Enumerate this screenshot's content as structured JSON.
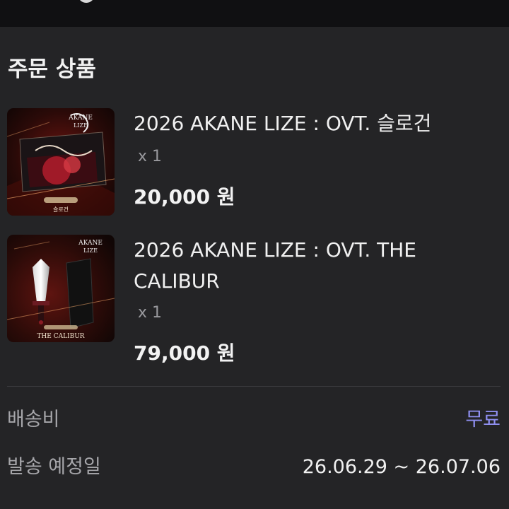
{
  "order": {
    "section_title": "주문 상품",
    "items": [
      {
        "name": "2026 AKANE LIZE : OVT. 슬로건",
        "quantity": "x 1",
        "price": "20,000 원",
        "thumbnail_caption": "슬로건"
      },
      {
        "name": "2026 AKANE LIZE : OVT. THE CALIBUR",
        "quantity": "x 1",
        "price": "79,000 원",
        "thumbnail_caption": "THE CALIBUR"
      }
    ]
  },
  "summary": {
    "shipping_label": "배송비",
    "shipping_value": "무료",
    "schedule_label": "발송 예정일",
    "schedule_value": "26.06.29 ~ 26.07.06"
  },
  "colors": {
    "background": "#242426",
    "free_accent": "#8f8ff0",
    "secondary_text": "#9a9a9e"
  }
}
